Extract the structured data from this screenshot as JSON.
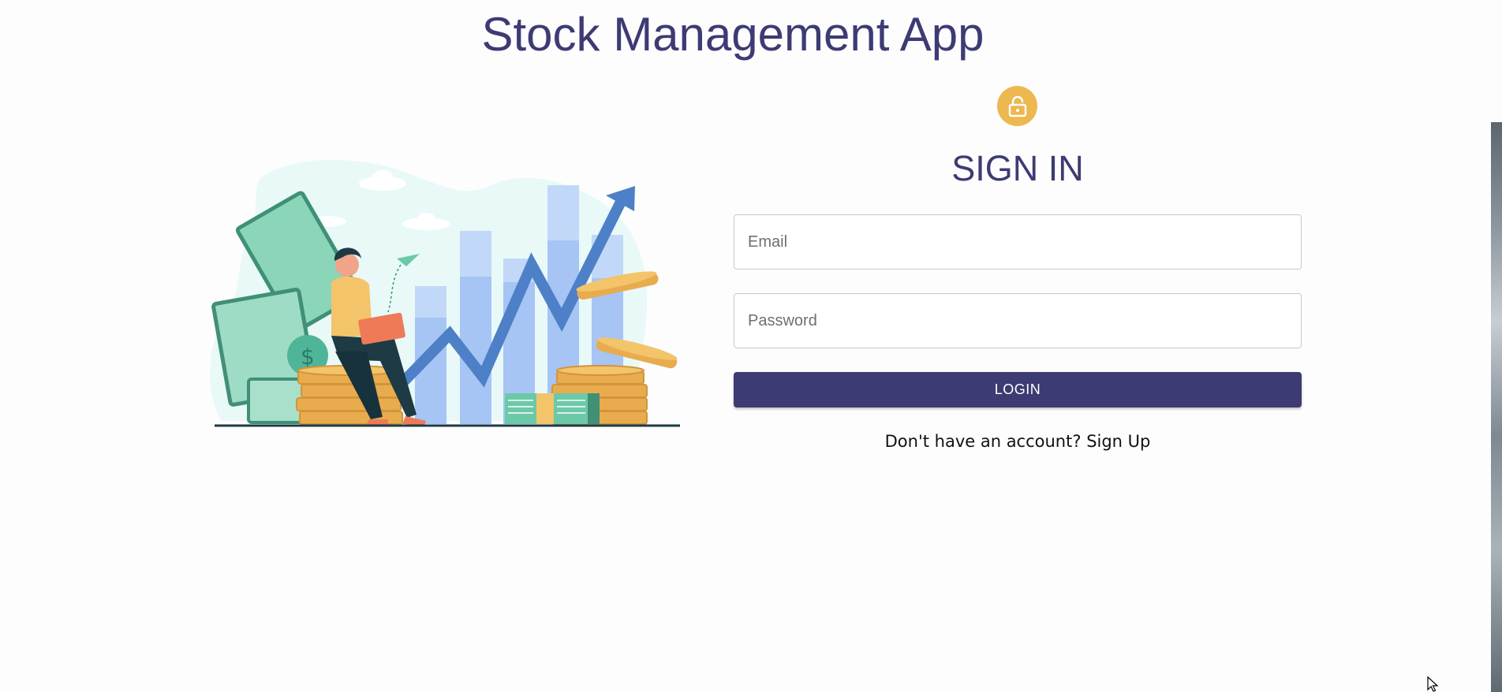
{
  "app": {
    "title": "Stock Management App"
  },
  "form": {
    "heading": "SIGN IN",
    "email_placeholder": "Email",
    "email_value": "",
    "password_placeholder": "Password",
    "password_value": "",
    "login_label": "LOGIN",
    "signup_prompt": "Don't have an account?",
    "signup_link": "Sign Up"
  },
  "icons": {
    "lock": "lock-open-icon",
    "illustration": "stock-growth-illustration",
    "cursor": "mouse-pointer-icon"
  },
  "colors": {
    "primary": "#3d3b73",
    "accent": "#ecb84f",
    "background": "#fdfdfd"
  }
}
